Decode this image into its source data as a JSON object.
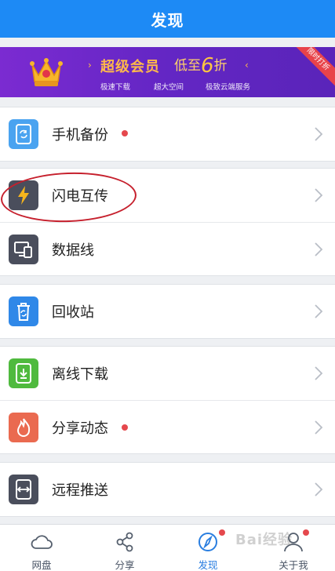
{
  "header": {
    "title": "发现"
  },
  "banner": {
    "title": "超级会员",
    "price_prefix": "低至",
    "price_num": "6",
    "price_suffix": "折",
    "features": [
      "极速下载",
      "超大空间",
      "极致云端服务"
    ],
    "ribbon": "限时打折",
    "colors": {
      "background": "#6a28c8",
      "accent": "#ffb94a"
    }
  },
  "groups": [
    {
      "items": [
        {
          "label": "手机备份",
          "icon": "phone-backup-icon",
          "color": "#4aa3f0",
          "badge": true
        }
      ]
    },
    {
      "items": [
        {
          "label": "闪电互传",
          "icon": "lightning-icon",
          "color": "#4a4e5c",
          "badge": false
        },
        {
          "label": "数据线",
          "icon": "data-cable-icon",
          "color": "#4a4e5c",
          "badge": false
        }
      ]
    },
    {
      "items": [
        {
          "label": "回收站",
          "icon": "recycle-bin-icon",
          "color": "#2f88e8",
          "badge": false
        }
      ]
    },
    {
      "items": [
        {
          "label": "离线下载",
          "icon": "offline-download-icon",
          "color": "#4fba3e",
          "badge": false
        },
        {
          "label": "分享动态",
          "icon": "share-feed-icon",
          "color": "#ea6a50",
          "badge": true
        }
      ]
    },
    {
      "items": [
        {
          "label": "远程推送",
          "icon": "remote-push-icon",
          "color": "#4a4e5c",
          "badge": false
        }
      ]
    }
  ],
  "tabbar": {
    "items": [
      {
        "label": "网盘",
        "icon": "cloud-icon",
        "active": false,
        "badge": false
      },
      {
        "label": "分享",
        "icon": "share-icon",
        "active": false,
        "badge": false
      },
      {
        "label": "发现",
        "icon": "compass-icon",
        "active": true,
        "badge": true
      },
      {
        "label": "关于我",
        "icon": "person-icon",
        "active": false,
        "badge": true
      }
    ]
  },
  "watermark": "Bai经验"
}
